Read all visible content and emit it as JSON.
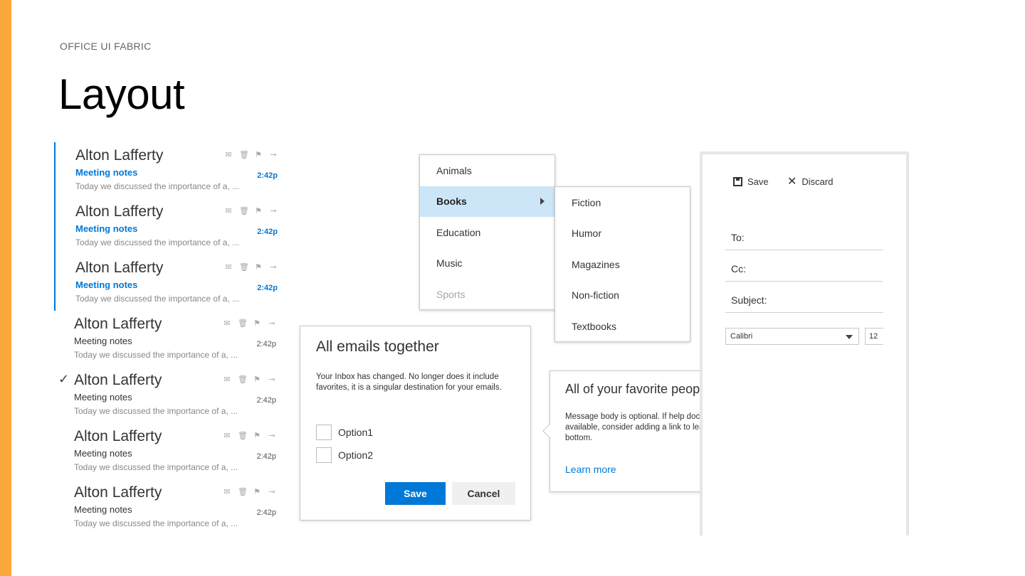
{
  "eyebrow": "OFFICE UI FABRIC",
  "title": "Layout",
  "colors": {
    "accent": "#FBA83A",
    "theme_primary": "#0078D7",
    "menu_active": "#CDE6F7"
  },
  "mail_list": {
    "items": [
      {
        "name": "Alton Lafferty",
        "subject": "Meeting notes",
        "time": "2:42p",
        "preview": "Today we discussed the importance of a, ...",
        "selected": true,
        "checked": false
      },
      {
        "name": "Alton Lafferty",
        "subject": "Meeting notes",
        "time": "2:42p",
        "preview": "Today we discussed the importance of a, ...",
        "selected": true,
        "checked": false
      },
      {
        "name": "Alton Lafferty",
        "subject": "Meeting notes",
        "time": "2:42p",
        "preview": "Today we discussed the importance of a, ...",
        "selected": true,
        "checked": false
      },
      {
        "name": "Alton Lafferty",
        "subject": "Meeting notes",
        "time": "2:42p",
        "preview": "Today we discussed the importance of a, ...",
        "selected": false,
        "checked": false
      },
      {
        "name": "Alton Lafferty",
        "subject": "Meeting notes",
        "time": "2:42p",
        "preview": "Today we discussed the importance of a, ...",
        "selected": false,
        "checked": true
      },
      {
        "name": "Alton Lafferty",
        "subject": "Meeting notes",
        "time": "2:42p",
        "preview": "Today we discussed the importance of a, ...",
        "selected": false,
        "checked": false
      },
      {
        "name": "Alton Lafferty",
        "subject": "Meeting notes",
        "time": "2:42p",
        "preview": "Today we discussed the importance of a, ...",
        "selected": false,
        "checked": false
      }
    ],
    "action_icons": [
      "mail-icon",
      "trash-icon",
      "flag-icon",
      "pin-icon"
    ]
  },
  "menu": {
    "items": [
      {
        "label": "Animals",
        "state": "normal"
      },
      {
        "label": "Books",
        "state": "active",
        "has_submenu": true
      },
      {
        "label": "Education",
        "state": "normal"
      },
      {
        "label": "Music",
        "state": "normal"
      },
      {
        "label": "Sports",
        "state": "disabled"
      }
    ],
    "submenu": [
      "Fiction",
      "Humor",
      "Magazines",
      "Non-fiction",
      "Textbooks"
    ]
  },
  "dialog": {
    "title": "All emails together",
    "body": "Your Inbox has changed. No longer does it include favorites, it is a singular destination for your emails.",
    "options": [
      "Option1",
      "Option2"
    ],
    "save_label": "Save",
    "cancel_label": "Cancel"
  },
  "callout": {
    "title": "All of your favorite people",
    "body": "Message body is optional. If help documentation is available, consider adding a link to learn more at the bottom.",
    "link": "Learn more"
  },
  "compose": {
    "save_label": "Save",
    "discard_label": "Discard",
    "to_label": "To:",
    "cc_label": "Cc:",
    "subject_label": "Subject:",
    "font_family": "Calibri",
    "font_size": "12"
  }
}
